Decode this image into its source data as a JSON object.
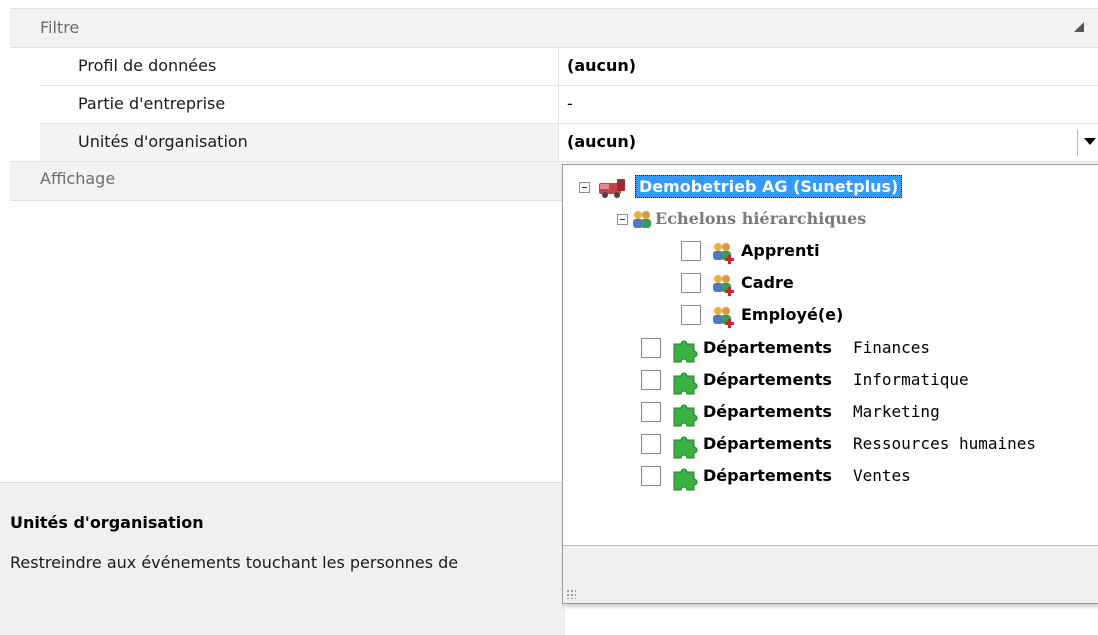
{
  "property_grid": {
    "categories": {
      "filtre": "Filtre",
      "affichage": "Affichage"
    },
    "rows": [
      {
        "name": "Profil de données",
        "value": "(aucun)"
      },
      {
        "name": "Partie d'entreprise",
        "value": "-"
      },
      {
        "name": "Unités d'organisation",
        "value": "(aucun)"
      }
    ]
  },
  "description": {
    "title": "Unités d'organisation",
    "text": "Restreindre aux événements touchant les personnes de"
  },
  "tree": {
    "root": {
      "label": "Demobetrieb AG (Sunetplus)",
      "icon": "company-truck-icon"
    },
    "group": {
      "label": "Echelons hiérarchiques",
      "icon": "people-group-icon"
    },
    "levels": [
      {
        "label": "Apprenti",
        "icon": "people-add-icon",
        "checked": false
      },
      {
        "label": "Cadre",
        "icon": "people-add-icon",
        "checked": false
      },
      {
        "label": "Employé(e)",
        "icon": "people-add-icon",
        "checked": false
      }
    ],
    "departments": [
      {
        "type": "Départements",
        "name": "Finances",
        "icon": "puzzle-icon",
        "checked": false
      },
      {
        "type": "Départements",
        "name": "Informatique",
        "icon": "puzzle-icon",
        "checked": false
      },
      {
        "type": "Départements",
        "name": "Marketing",
        "icon": "puzzle-icon",
        "checked": false
      },
      {
        "type": "Départements",
        "name": "Ressources humaines",
        "icon": "puzzle-icon",
        "checked": false
      },
      {
        "type": "Départements",
        "name": "Ventes",
        "icon": "puzzle-icon",
        "checked": false
      }
    ]
  },
  "colors": {
    "selection": "#3399ff",
    "category_bg": "#f2f2f2",
    "puzzle_green": "#3cb043"
  }
}
